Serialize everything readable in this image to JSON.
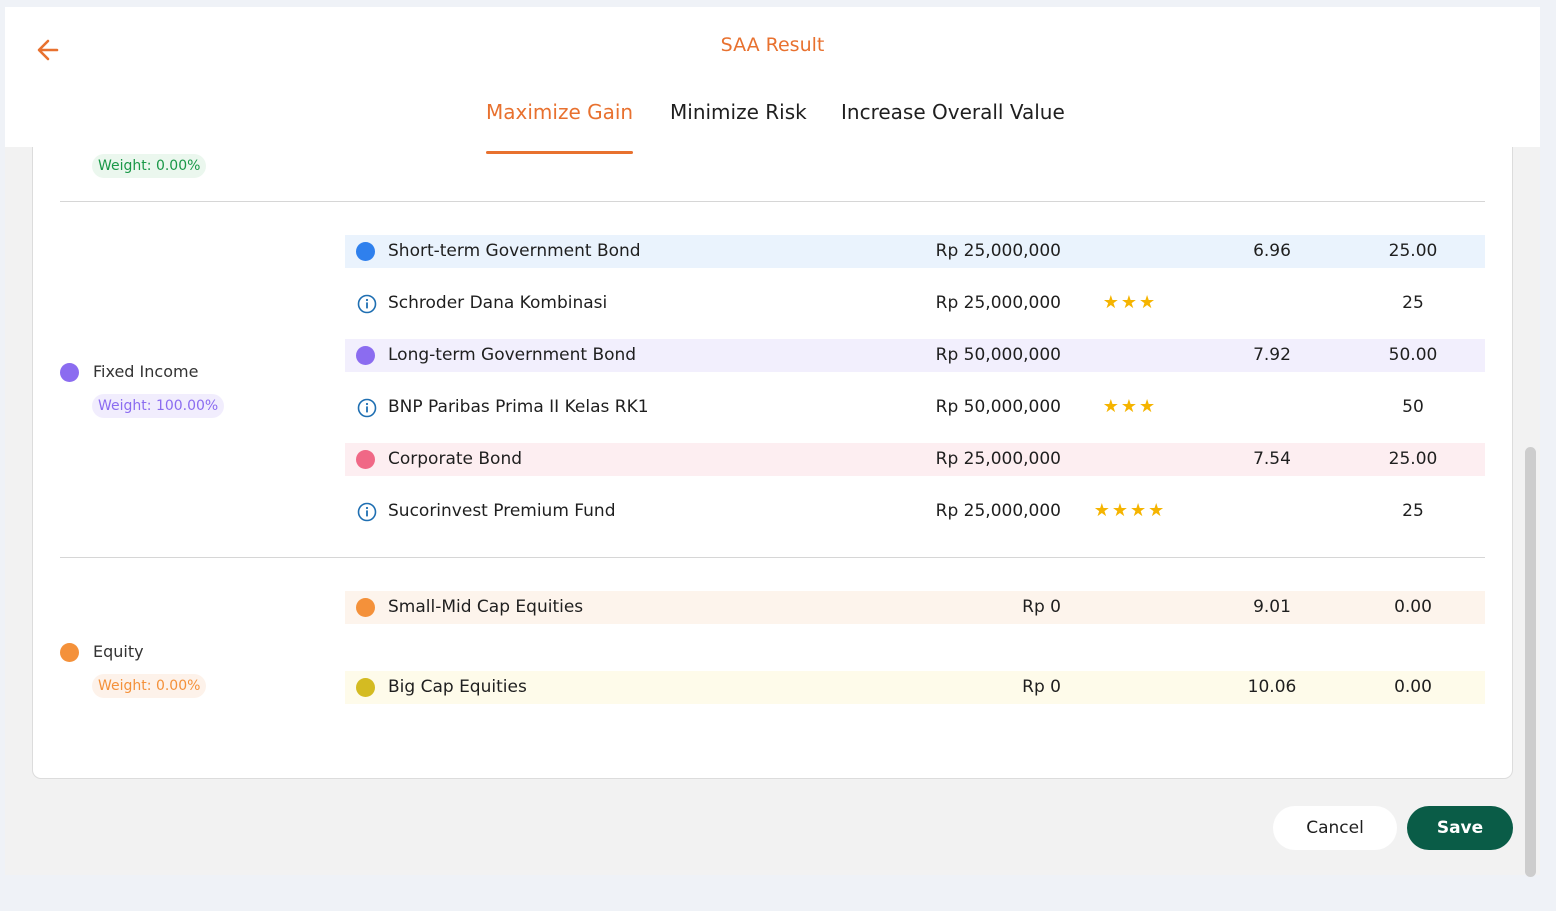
{
  "header": {
    "title": "SAA Result",
    "back_icon": "arrow-left-icon"
  },
  "tabs": [
    {
      "label": "Maximize Gain",
      "active": true
    },
    {
      "label": "Minimize Risk",
      "active": false
    },
    {
      "label": "Increase Overall Value",
      "active": false
    }
  ],
  "asset_classes": [
    {
      "name": "",
      "weight": "Weight: 0.00%",
      "color": "#1a9848",
      "weight_bg": "#ebf7ee"
    },
    {
      "name": "Fixed Income",
      "weight": "Weight: 100.00%",
      "color": "#8b6cf0",
      "weight_bg": "#f1edfd"
    },
    {
      "name": "Equity",
      "weight": "Weight: 0.00%",
      "color": "#f4913a",
      "weight_bg": "#fdf2ea"
    }
  ],
  "rows": [
    {
      "kind": "category",
      "name": "Short-term Government Bond",
      "amount": "Rp 25,000,000",
      "stars": "",
      "return": "6.96",
      "pct": "25.00",
      "color": "#2f80ed",
      "bg": "#eaf3fd"
    },
    {
      "kind": "fund",
      "name": "Schroder Dana Kombinasi",
      "amount": "Rp 25,000,000",
      "stars": "★★★",
      "return": "",
      "pct": "25"
    },
    {
      "kind": "category",
      "name": "Long-term Government Bond",
      "amount": "Rp 50,000,000",
      "stars": "",
      "return": "7.92",
      "pct": "50.00",
      "color": "#8b6cf0",
      "bg": "#f2effd"
    },
    {
      "kind": "fund",
      "name": "BNP Paribas Prima II Kelas RK1",
      "amount": "Rp 50,000,000",
      "stars": "★★★",
      "return": "",
      "pct": "50"
    },
    {
      "kind": "category",
      "name": "Corporate Bond",
      "amount": "Rp 25,000,000",
      "stars": "",
      "return": "7.54",
      "pct": "25.00",
      "color": "#f06886",
      "bg": "#fdeef1"
    },
    {
      "kind": "fund",
      "name": "Sucorinvest Premium Fund",
      "amount": "Rp 25,000,000",
      "stars": "★★★★",
      "return": "",
      "pct": "25"
    },
    {
      "kind": "category",
      "name": "Small-Mid Cap Equities",
      "amount": "Rp 0",
      "stars": "",
      "return": "9.01",
      "pct": "0.00",
      "color": "#f4913a",
      "bg": "#fdf4ec"
    },
    {
      "kind": "category",
      "name": "Big Cap Equities",
      "amount": "Rp 0",
      "stars": "",
      "return": "10.06",
      "pct": "0.00",
      "color": "#d4bb22",
      "bg": "#fefbea"
    }
  ],
  "fund_icon": "info-icon",
  "star_icon": "star-icon",
  "buttons": {
    "cancel": "Cancel",
    "save": "Save"
  },
  "colors": {
    "accent": "#e8712f",
    "primary": "#0a5c47",
    "info": "#1f6fb2"
  }
}
